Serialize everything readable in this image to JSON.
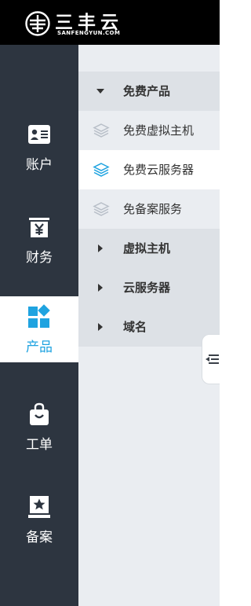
{
  "brand": {
    "name_cn": "三丰云",
    "name_en": "SANFENGYUN.COM",
    "logo_icon": "sanfengyun-logo-icon"
  },
  "left_nav": {
    "items": [
      {
        "label": "账户",
        "icon": "id-card-icon",
        "active": false
      },
      {
        "label": "财务",
        "icon": "yuan-receipt-icon",
        "active": false
      },
      {
        "label": "产品",
        "icon": "product-grid-icon",
        "active": true
      },
      {
        "label": "工单",
        "icon": "shopping-bag-icon",
        "active": false
      },
      {
        "label": "备案",
        "icon": "star-badge-icon",
        "active": false
      }
    ],
    "active_color": "#1fa3e0",
    "background": "#2d3540"
  },
  "sub_menu": {
    "free_products": {
      "label": "免费产品",
      "expanded": true,
      "items": [
        {
          "label": "免费虚拟主机",
          "selected": false
        },
        {
          "label": "免费云服务器",
          "selected": true
        },
        {
          "label": "免备案服务",
          "selected": false
        }
      ]
    },
    "virtual_host": {
      "label": "虚拟主机",
      "expanded": false
    },
    "cloud_server": {
      "label": "云服务器",
      "expanded": false
    },
    "domain": {
      "label": "域名",
      "expanded": false
    }
  },
  "collapse_toggle": {
    "icon": "collapse-sidebar-icon"
  }
}
